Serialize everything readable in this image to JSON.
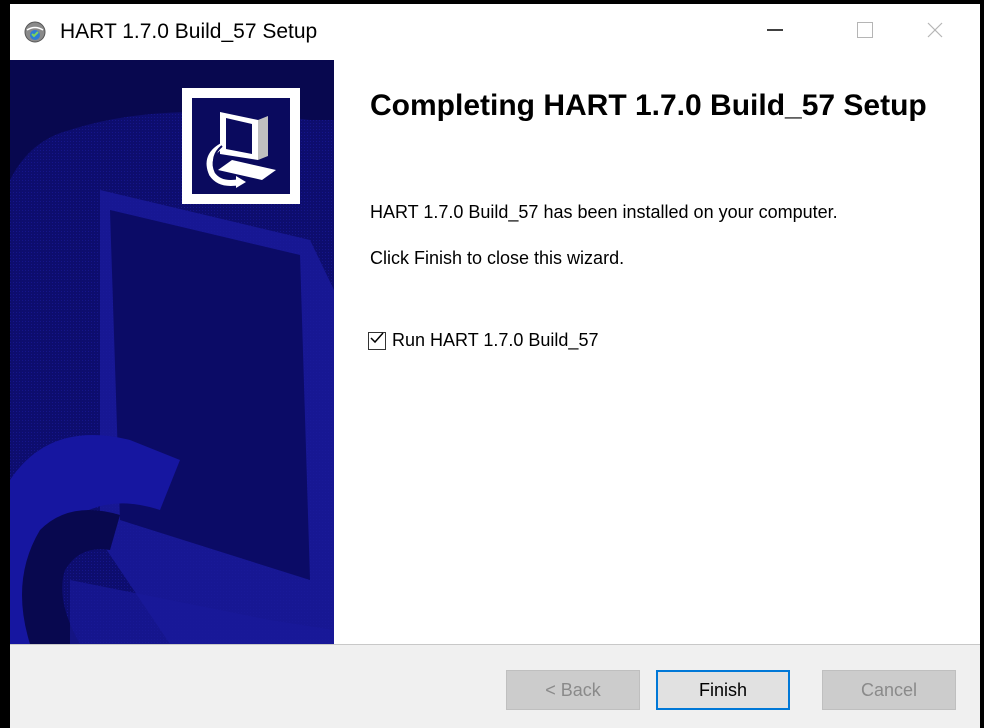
{
  "window": {
    "title": "HART 1.7.0 Build_57 Setup",
    "icon": "setup-globe-icon",
    "controls": [
      "minimize-icon",
      "maximize-icon",
      "close-icon"
    ]
  },
  "banner": {
    "logo_icon": "installer-computer-icon",
    "background_color": "#0a0a5e"
  },
  "content": {
    "heading": "Completing HART 1.7.0 Build_57 Setup",
    "message_installed": "HART 1.7.0 Build_57 has been installed on your computer.",
    "message_finish": "Click Finish to close this wizard.",
    "run_checkbox": {
      "label": "Run HART 1.7.0 Build_57",
      "checked": true
    }
  },
  "buttons": {
    "back_label": "< Back",
    "finish_label": "Finish",
    "cancel_label": "Cancel"
  },
  "colors": {
    "accent": "#0078d7",
    "disabled_button": "#cccccc"
  }
}
